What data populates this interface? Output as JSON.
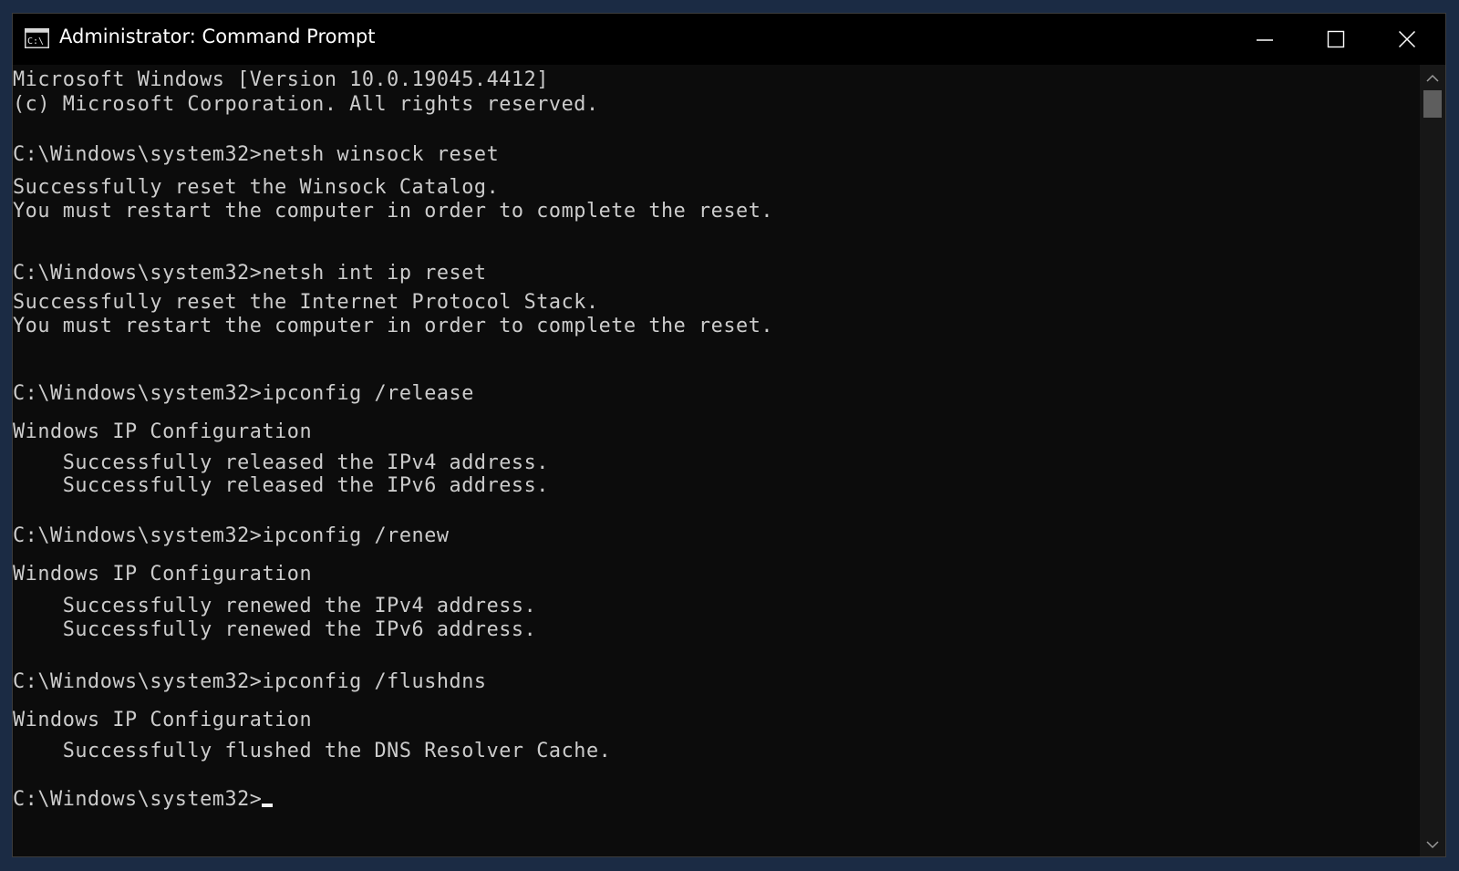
{
  "window": {
    "title": "Administrator: Command Prompt",
    "app_icon": "cmd-icon",
    "buttons": {
      "minimize": "minimize-icon",
      "maximize": "maximize-icon",
      "close": "close-icon"
    }
  },
  "console": {
    "lines": [
      "Microsoft Windows [Version 10.0.19045.4412]",
      "(c) Microsoft Corporation. All rights reserved.",
      "C:\\Windows\\system32>netsh winsock reset",
      "Successfully reset the Winsock Catalog.",
      "You must restart the computer in order to complete the reset.",
      "C:\\Windows\\system32>netsh int ip reset",
      "Successfully reset the Internet Protocol Stack.",
      "You must restart the computer in order to complete the reset.",
      "C:\\Windows\\system32>ipconfig /release",
      "Windows IP Configuration",
      "    Successfully released the IPv4 address.",
      "    Successfully released the IPv6 address.",
      "C:\\Windows\\system32>ipconfig /renew",
      "Windows IP Configuration",
      "    Successfully renewed the IPv4 address.",
      "    Successfully renewed the IPv6 address.",
      "C:\\Windows\\system32>ipconfig /flushdns",
      "Windows IP Configuration",
      "    Successfully flushed the DNS Resolver Cache.",
      "C:\\Windows\\system32>"
    ]
  },
  "colors": {
    "console_background": "#0c0c0c",
    "console_text": "#cccccc",
    "titlebar": "#000000"
  }
}
